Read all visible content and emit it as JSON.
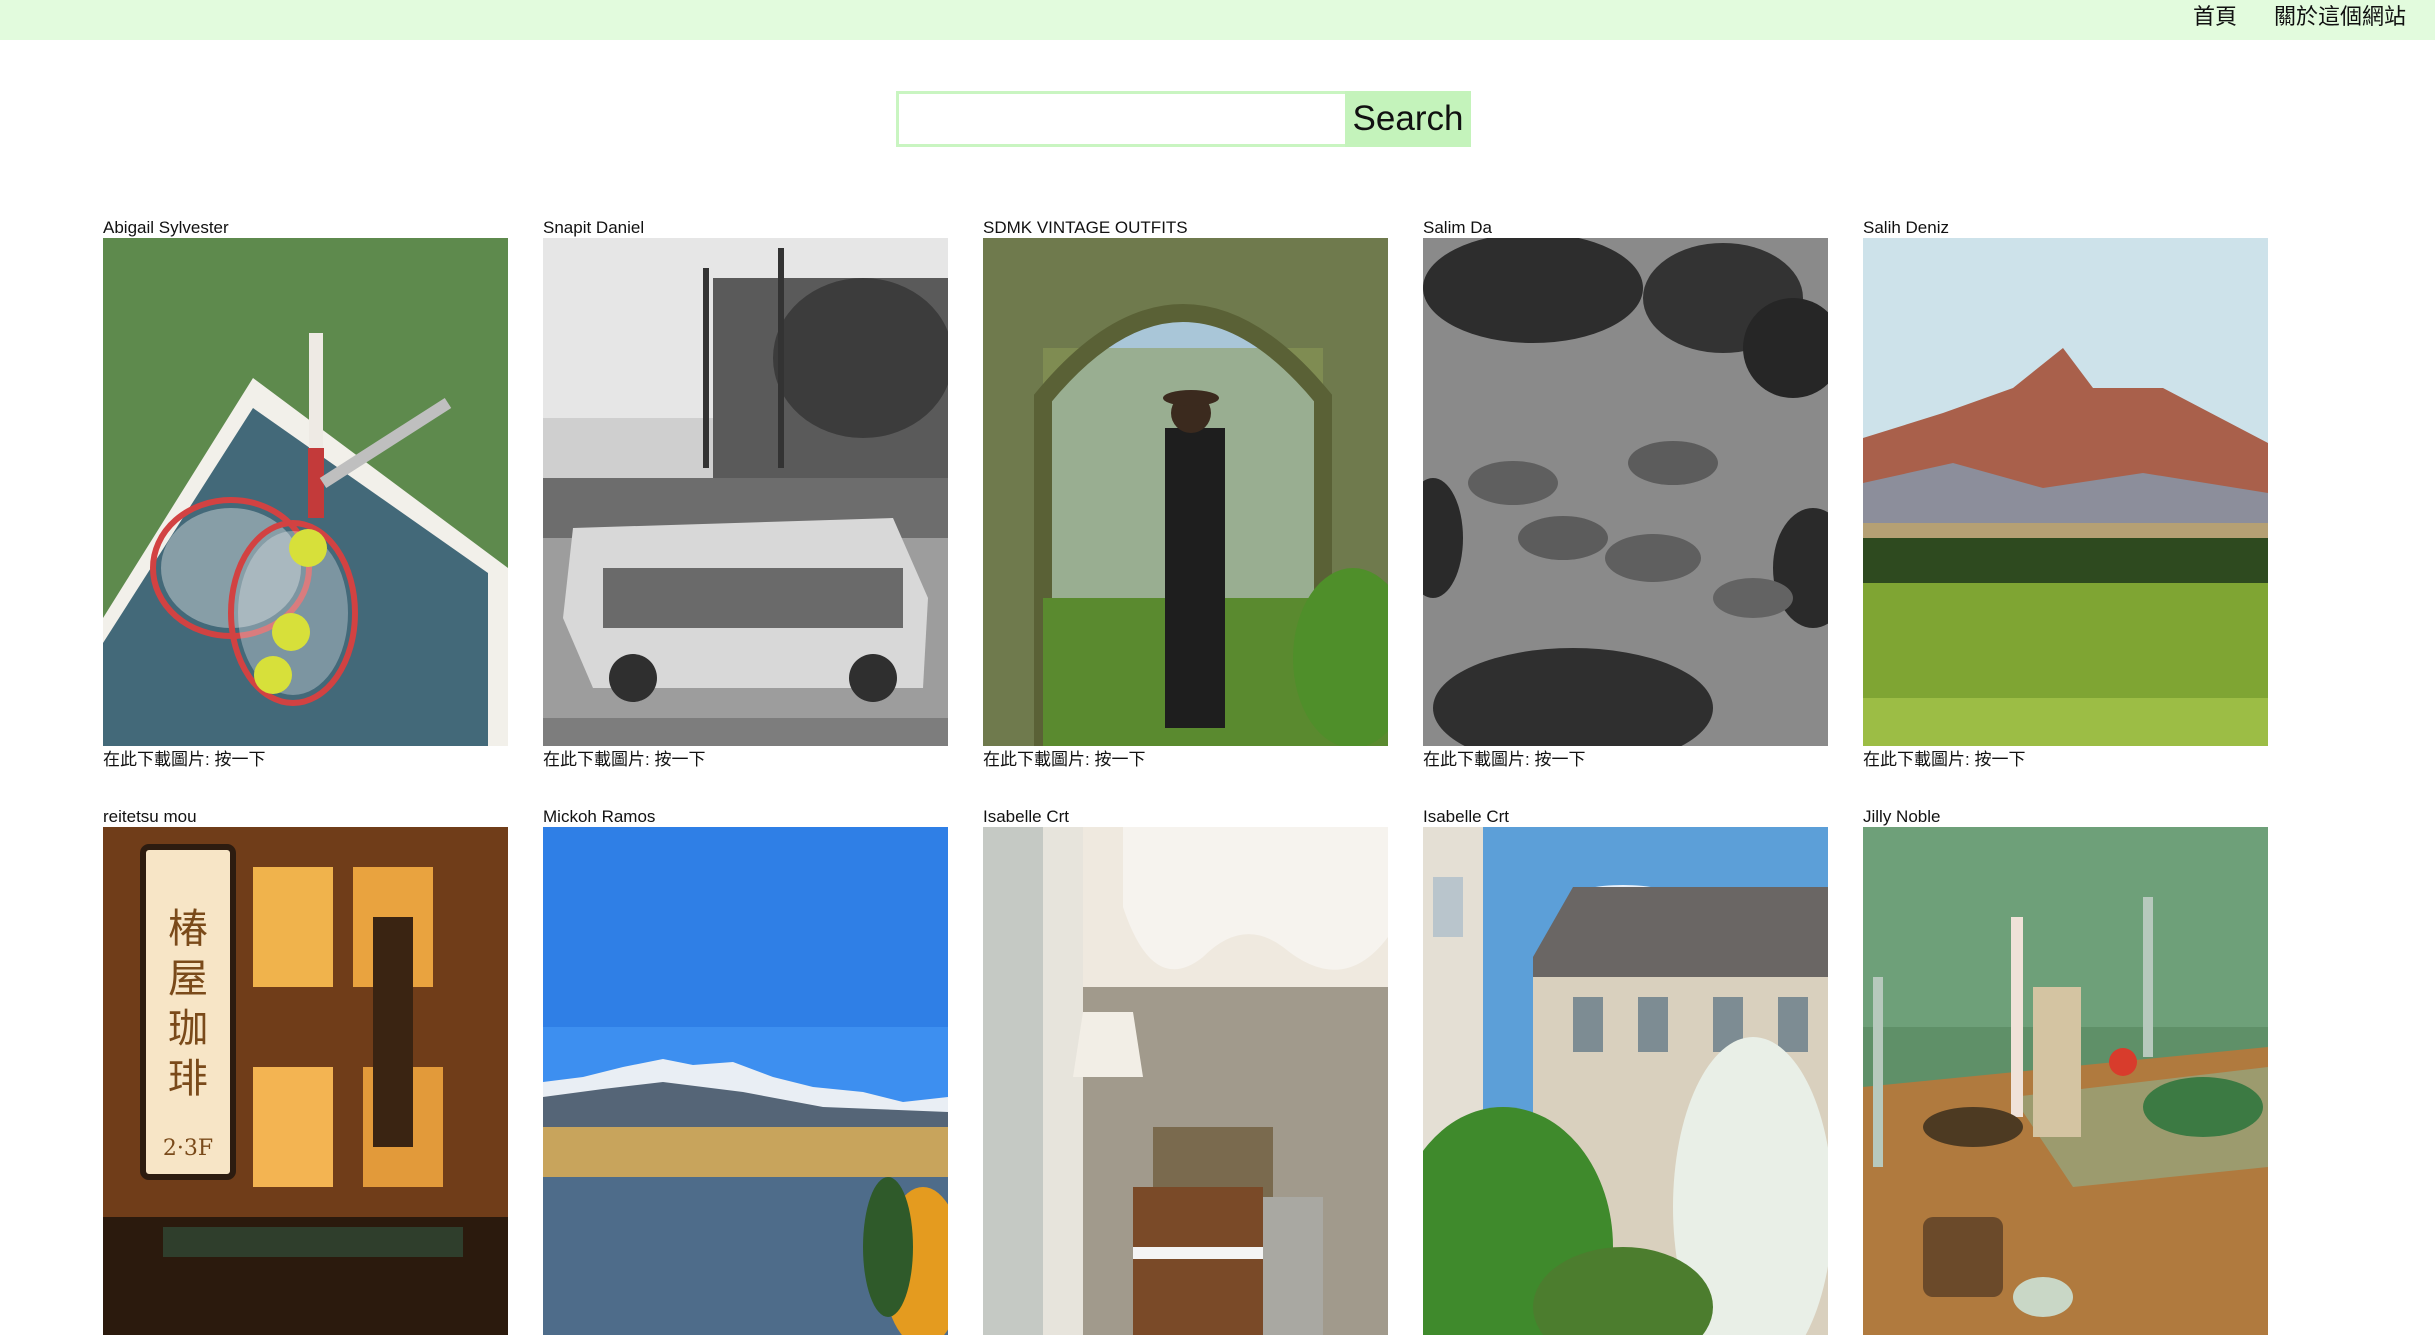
{
  "nav": {
    "home": "首頁",
    "about": "關於這個網站"
  },
  "search": {
    "placeholder": "",
    "value": "",
    "button_label": "Search"
  },
  "download_text": "在此下載圖片: 按一下",
  "photos": [
    {
      "author": "Abigail Sylvester",
      "subject": "tennis rackets and balls"
    },
    {
      "author": "Snapit Daniel",
      "subject": "vintage car parade"
    },
    {
      "author": "SDMK VINTAGE OUTFITS",
      "subject": "man in coat under arch"
    },
    {
      "author": "Salim Da",
      "subject": "footprints in sand"
    },
    {
      "author": "Salih Deniz",
      "subject": "mountain and meadow"
    },
    {
      "author": "reitetsu mou",
      "subject": "cafe signboard at night",
      "sign_text": "椿屋珈琲",
      "sign_sub": "2·3F"
    },
    {
      "author": "Mickoh Ramos",
      "subject": "snowy mountains and lake"
    },
    {
      "author": "Isabelle Crt",
      "subject": "restaurant interior"
    },
    {
      "author": "Isabelle Crt",
      "subject": "building courtyard with ivy"
    },
    {
      "author": "Jilly Noble",
      "subject": "festive table with candles"
    }
  ]
}
